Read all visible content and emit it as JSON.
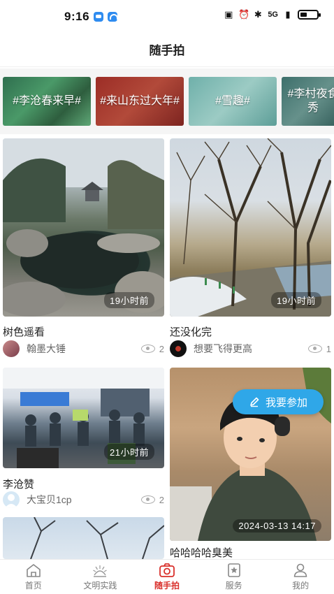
{
  "status_bar": {
    "time": "9:16",
    "network": "5G"
  },
  "header": {
    "title": "随手拍"
  },
  "topics": [
    {
      "label": "#李沧春来早#"
    },
    {
      "label": "#来山东过大年#"
    },
    {
      "label": "#雪趣#"
    },
    {
      "label": "#李村夜食秀"
    }
  ],
  "posts": [
    {
      "title": "树色遥看",
      "author": "翰墨大锤",
      "views": "2",
      "time": "19小时前"
    },
    {
      "title": "还没化完",
      "author": "想要飞得更高",
      "views": "1",
      "time": "19小时前"
    },
    {
      "title": "李沧赞",
      "author": "大宝贝1cp",
      "views": "2",
      "time": "21小时前"
    },
    {
      "title": "哈哈哈哈臭美",
      "author": "",
      "views": "",
      "time": "2024-03-13  14:17"
    },
    {
      "title": "",
      "author": "",
      "views": "",
      "time": ""
    }
  ],
  "join_button": {
    "label": "我要参加"
  },
  "tabbar": {
    "active": "随手拍",
    "items": [
      {
        "label": "首页",
        "icon": "home-icon"
      },
      {
        "label": "文明实践",
        "icon": "sunrise-icon"
      },
      {
        "label": "随手拍",
        "icon": "camera-icon"
      },
      {
        "label": "服务",
        "icon": "star-badge-icon"
      },
      {
        "label": "我的",
        "icon": "user-icon"
      }
    ]
  },
  "colors": {
    "accent": "#d9302b",
    "join_button": "#2fa7e8"
  }
}
